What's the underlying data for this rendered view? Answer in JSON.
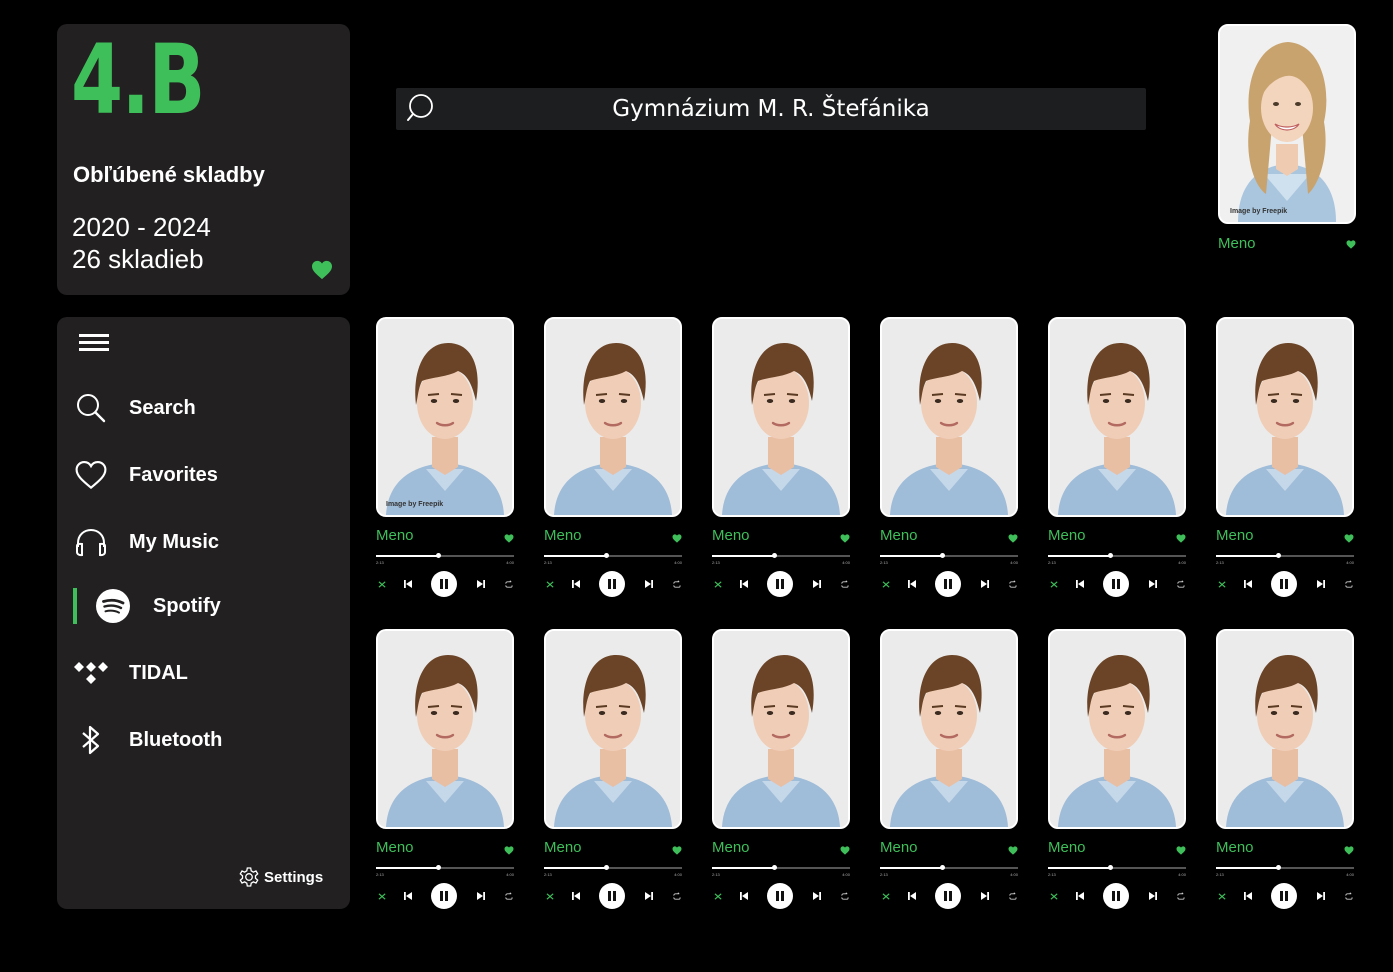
{
  "class_card": {
    "title": "4.B",
    "playlist": "Obľúbené skladby",
    "years": "2020 - 2024",
    "track_count": "26 skladieb"
  },
  "search": {
    "text": "Gymnázium M. R. Štefánika"
  },
  "teacher": {
    "name": "Meno",
    "credit": "Image by Freepik"
  },
  "sidebar": {
    "items": [
      {
        "label": "Search",
        "icon": "search-icon"
      },
      {
        "label": "Favorites",
        "icon": "heart-icon"
      },
      {
        "label": "My Music",
        "icon": "headphones-icon"
      },
      {
        "label": "Spotify",
        "icon": "spotify-icon",
        "active": true
      },
      {
        "label": "TIDAL",
        "icon": "tidal-icon"
      },
      {
        "label": "Bluetooth",
        "icon": "bluetooth-icon"
      }
    ],
    "settings": "Settings"
  },
  "students": [
    {
      "name": "Meno",
      "credit": "Image by Freepik",
      "elapsed": "2:13",
      "total": "4:00",
      "progress": 0.45
    },
    {
      "name": "Meno",
      "credit": "",
      "elapsed": "2:13",
      "total": "4:00",
      "progress": 0.45
    },
    {
      "name": "Meno",
      "credit": "",
      "elapsed": "2:13",
      "total": "4:00",
      "progress": 0.45
    },
    {
      "name": "Meno",
      "credit": "",
      "elapsed": "2:13",
      "total": "4:00",
      "progress": 0.45
    },
    {
      "name": "Meno",
      "credit": "",
      "elapsed": "2:13",
      "total": "4:00",
      "progress": 0.45
    },
    {
      "name": "Meno",
      "credit": "",
      "elapsed": "2:13",
      "total": "4:00",
      "progress": 0.45
    },
    {
      "name": "Meno",
      "credit": "",
      "elapsed": "2:13",
      "total": "4:00",
      "progress": 0.45
    },
    {
      "name": "Meno",
      "credit": "",
      "elapsed": "2:13",
      "total": "4:00",
      "progress": 0.45
    },
    {
      "name": "Meno",
      "credit": "",
      "elapsed": "2:13",
      "total": "4:00",
      "progress": 0.45
    },
    {
      "name": "Meno",
      "credit": "",
      "elapsed": "2:13",
      "total": "4:00",
      "progress": 0.45
    },
    {
      "name": "Meno",
      "credit": "",
      "elapsed": "2:13",
      "total": "4:00",
      "progress": 0.45
    },
    {
      "name": "Meno",
      "credit": "",
      "elapsed": "2:13",
      "total": "4:00",
      "progress": 0.45
    }
  ],
  "colors": {
    "accent": "#3fbf5a",
    "panel": "#222021",
    "background": "#000000",
    "search_bg": "#1d1e20"
  }
}
